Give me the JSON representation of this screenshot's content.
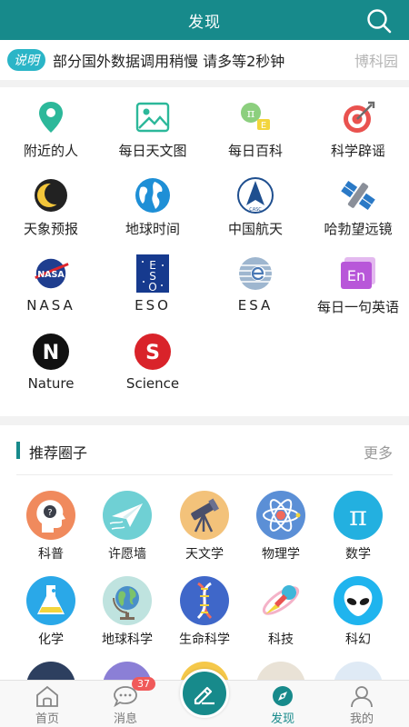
{
  "header": {
    "title": "发现"
  },
  "notice": {
    "badge": "说明",
    "text": "部分国外数据调用稍慢 请多等2秒钟",
    "source": "博科园"
  },
  "apps": [
    {
      "label": "附近的人",
      "icon": "location-pin-icon"
    },
    {
      "label": "每日天文图",
      "icon": "picture-icon"
    },
    {
      "label": "每日百科",
      "icon": "encyclopedia-icon"
    },
    {
      "label": "科学辟谣",
      "icon": "target-icon"
    },
    {
      "label": "天象预报",
      "icon": "moon-icon"
    },
    {
      "label": "地球时间",
      "icon": "earth-icon"
    },
    {
      "label": "中国航天",
      "icon": "casc-logo-icon"
    },
    {
      "label": "哈勃望远镜",
      "icon": "satellite-icon"
    },
    {
      "label": "NASA",
      "icon": "nasa-logo-icon"
    },
    {
      "label": "ESO",
      "icon": "eso-logo-icon"
    },
    {
      "label": "ESA",
      "icon": "esa-logo-icon"
    },
    {
      "label": "每日一句英语",
      "icon": "english-icon"
    },
    {
      "label": "Nature",
      "icon": "nature-logo-icon"
    },
    {
      "label": "Science",
      "icon": "science-logo-icon"
    }
  ],
  "circles_section": {
    "title": "推荐圈子",
    "more": "更多"
  },
  "circles": [
    {
      "label": "科普",
      "icon": "head-question-icon"
    },
    {
      "label": "许愿墙",
      "icon": "paper-plane-icon"
    },
    {
      "label": "天文学",
      "icon": "telescope-icon"
    },
    {
      "label": "物理学",
      "icon": "atom-icon"
    },
    {
      "label": "数学",
      "icon": "pi-icon"
    },
    {
      "label": "化学",
      "icon": "flask-icon"
    },
    {
      "label": "地球科学",
      "icon": "globe-icon"
    },
    {
      "label": "生命科学",
      "icon": "dna-icon"
    },
    {
      "label": "科技",
      "icon": "rocket-planet-icon"
    },
    {
      "label": "科幻",
      "icon": "alien-icon"
    }
  ],
  "nav": {
    "items": [
      {
        "label": "首页",
        "icon": "home-icon"
      },
      {
        "label": "消息",
        "icon": "message-icon",
        "badge": "37"
      },
      {
        "label": "发现",
        "icon": "compass-icon",
        "active": true
      },
      {
        "label": "我的",
        "icon": "user-icon"
      }
    ],
    "fab_icon": "edit-icon"
  },
  "colors": {
    "primary": "#178a8b",
    "badge_red": "#f05a5a",
    "notice_badge": "#2bb5c7"
  }
}
